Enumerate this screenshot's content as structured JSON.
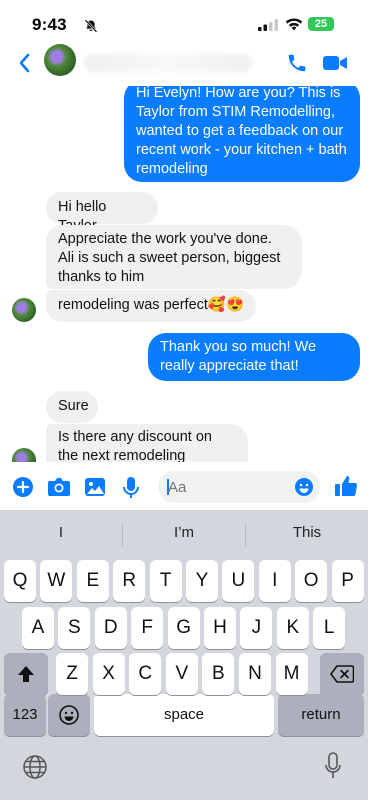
{
  "status_bar": {
    "time": "9:43",
    "battery": "25"
  },
  "header": {
    "contact_name": ""
  },
  "messages": [
    {
      "dir": "out",
      "text": "Hi Evelyn! How are you? This is Taylor from STIM Remodelling, wanted to get a feedback on our recent work - your kitchen + bath remodeling"
    },
    {
      "dir": "in",
      "text": "Hi hello Taylor"
    },
    {
      "dir": "in",
      "text": "Appreciate the work you've done. Ali is such a sweet person, biggest thanks to him"
    },
    {
      "dir": "in",
      "text": "remodeling was perfect🥰😍"
    },
    {
      "dir": "out",
      "text": "Thank you so much! We really appreciate that!"
    },
    {
      "dir": "in",
      "text": "Sure"
    },
    {
      "dir": "in",
      "text": "Is there any discount on the next remodeling"
    }
  ],
  "composer": {
    "placeholder": "Aa"
  },
  "keyboard": {
    "suggestions": [
      "I",
      "I’m",
      "This"
    ],
    "row1": [
      "Q",
      "W",
      "E",
      "R",
      "T",
      "Y",
      "U",
      "I",
      "O",
      "P"
    ],
    "row2": [
      "A",
      "S",
      "D",
      "F",
      "G",
      "H",
      "J",
      "K",
      "L"
    ],
    "row3": [
      "Z",
      "X",
      "C",
      "V",
      "B",
      "N",
      "M"
    ],
    "numbers_label": "123",
    "space_label": "space",
    "return_label": "return"
  },
  "colors": {
    "accent": "#0a7cff",
    "incoming_bubble": "#f0f0f0",
    "keyboard_bg": "#d3d6dc"
  },
  "icons": [
    "back-chevron-icon",
    "phone-icon",
    "video-icon",
    "plus-icon",
    "camera-icon",
    "gallery-icon",
    "microphone-icon",
    "emoji-icon",
    "thumbs-up-icon",
    "shift-icon",
    "backspace-icon",
    "keyboard-emoji-icon",
    "globe-icon",
    "dictation-icon",
    "bell-slash-icon",
    "cellular-icon",
    "wifi-icon"
  ]
}
